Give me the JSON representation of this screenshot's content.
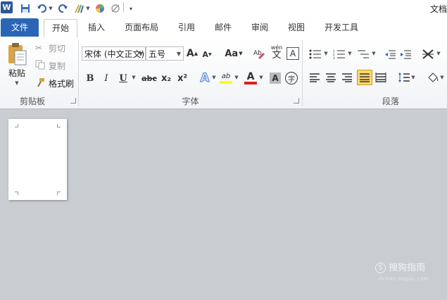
{
  "window": {
    "title": "文档"
  },
  "quick_access": {
    "app_icon": "W"
  },
  "tabs": {
    "file": "文件",
    "home": "开始",
    "insert": "插入",
    "layout": "页面布局",
    "references": "引用",
    "mailings": "邮件",
    "review": "审阅",
    "view": "视图",
    "developer": "开发工具"
  },
  "clipboard": {
    "group_label": "剪贴板",
    "paste": "粘贴",
    "cut": "剪切",
    "copy": "复制",
    "format_painter": "格式刷"
  },
  "font": {
    "group_label": "字体",
    "font_name": "宋体 (中文正文)",
    "font_size": "五号",
    "grow": "A",
    "shrink": "A",
    "change_case": "Aa",
    "bold": "B",
    "italic": "I",
    "underline": "U",
    "strikethrough": "abc",
    "subscript": "x₂",
    "superscript": "x²",
    "highlight": "ab",
    "font_color": "A",
    "shading": "A",
    "enclose": "字",
    "phonetic": "wén",
    "phonetic_char": "文"
  },
  "paragraph": {
    "group_label": "段落"
  },
  "watermark": {
    "brand": "搜狗指南",
    "url": "zhinan.sogou.com"
  },
  "colors": {
    "file_tab": "#2b66b6",
    "highlight": "#ffff00",
    "font_red": "#e02020",
    "justify_active": "#fcd86a"
  }
}
